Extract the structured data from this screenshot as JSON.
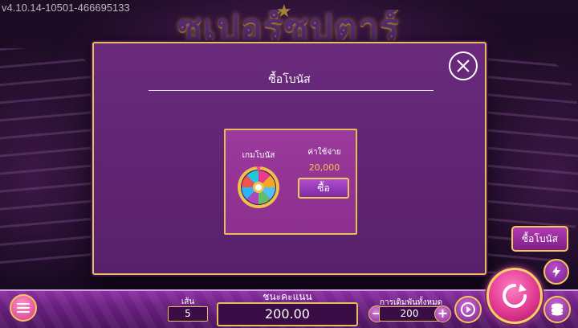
{
  "version": "v4.10.14-10501-466695133",
  "logo": {
    "text": "ซูเปอร์ซุปตาร์"
  },
  "modal": {
    "title": "ซื้อโบนัส",
    "bonus_game_label": "เกมโบนัส",
    "cost_label": "ค่าใช้จ่าย",
    "cost_value": "20,000",
    "buy_label": "ซื้อ"
  },
  "side": {
    "buy_bonus_label": "ซื้อโบนัส"
  },
  "bottom": {
    "lines_label": "เส้น",
    "lines_value": "5",
    "win_label": "ชนะคะแนน",
    "win_value": "200.00",
    "total_bet_label": "การเดิมพันทั้งหมด",
    "total_bet_value": "200",
    "minus_label": "−",
    "plus_label": "+"
  },
  "colors": {
    "accent_gold": "#e5bd59",
    "modal_purple": "#5e2370",
    "card_purple": "#9b3a9c",
    "spin_pink": "#e23a93",
    "cost_gold": "#f3c64b"
  },
  "icons": {
    "close": "close-icon",
    "wheel": "prize-wheel-icon",
    "menu": "menu-icon",
    "spin": "spin-icon",
    "autoplay": "autoplay-icon",
    "turbo": "turbo-lightning-icon",
    "coins": "coin-stack-icon"
  }
}
